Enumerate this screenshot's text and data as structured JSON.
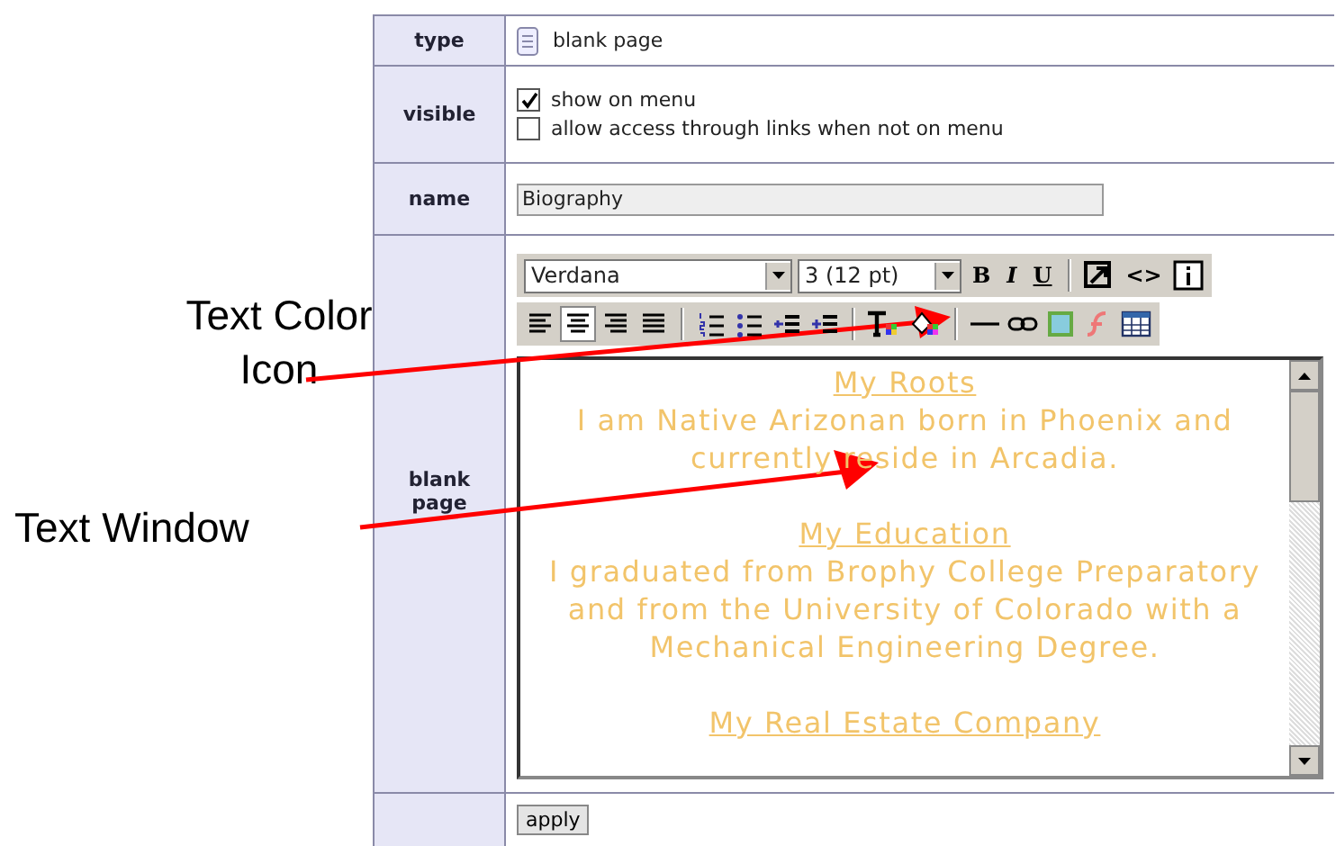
{
  "form": {
    "rows": [
      {
        "kind": "type",
        "label": "type",
        "value": "blank page"
      },
      {
        "kind": "checks",
        "label": "visible",
        "options": [
          {
            "label": "show on menu",
            "checked": true
          },
          {
            "label": "allow access through links when not on menu",
            "checked": false
          }
        ]
      },
      {
        "kind": "input",
        "label": "name",
        "value": "Biography"
      },
      {
        "kind": "editor",
        "label": "blank page"
      }
    ]
  },
  "editor": {
    "font_select": "Verdana",
    "size_select": "3 (12 pt)",
    "format_buttons": [
      "B",
      "I",
      "U"
    ],
    "source_button": "<>",
    "content": [
      {
        "heading": "My Roots",
        "text": "I am Native Arizonan born in Phoenix and currently reside in Arcadia."
      },
      {
        "heading": "My Education",
        "text": "I graduated from Brophy College Preparatory and from the University of Colorado with a Mechanical Engineering Degree."
      },
      {
        "heading": "My Real Estate Company"
      }
    ]
  },
  "apply_button": "apply",
  "annotations": [
    {
      "label": "Text Color Icon"
    },
    {
      "label": "Text Window"
    }
  ]
}
